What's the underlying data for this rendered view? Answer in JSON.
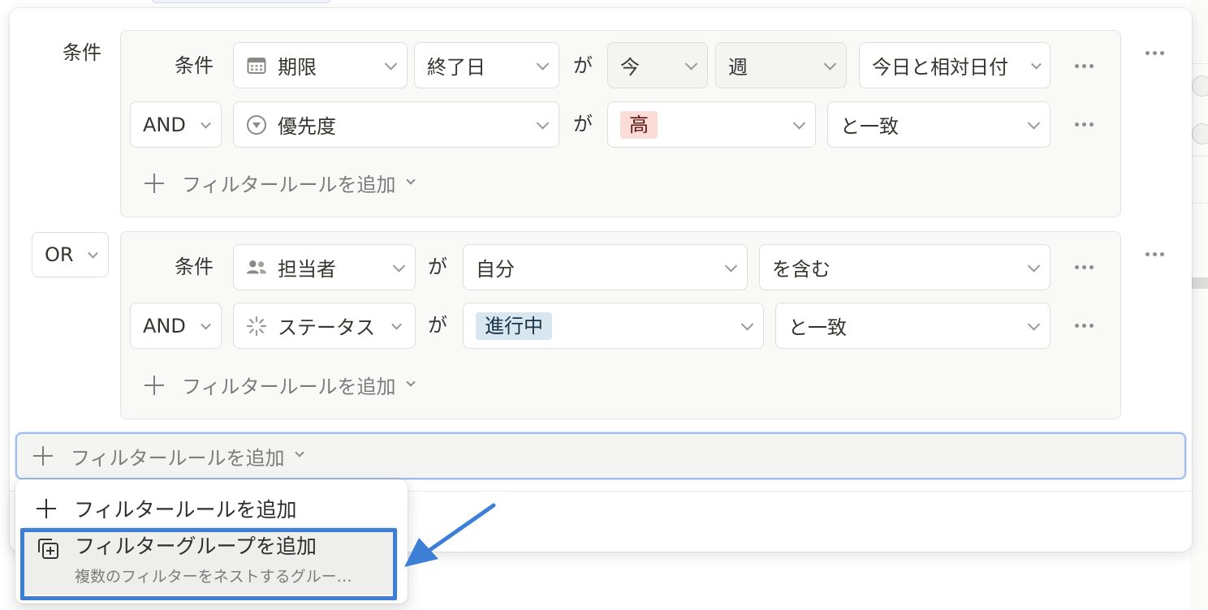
{
  "filters": {
    "top_label": "条件",
    "group1": {
      "rule1": {
        "prefix": "条件",
        "property": "期限",
        "property_icon": "calendar-icon",
        "field": "終了日",
        "verb": "が",
        "relative": "今",
        "unit": "週",
        "operator": "今日と相対日付"
      },
      "rule2": {
        "prefix": "AND",
        "property": "優先度",
        "property_icon": "select-icon",
        "verb": "が",
        "value": "高",
        "value_color": "#fbdcd7",
        "operator": "と一致"
      },
      "add_label": "フィルタールールを追加"
    },
    "group2_connector": "OR",
    "group2": {
      "rule1": {
        "prefix": "条件",
        "property": "担当者",
        "property_icon": "people-icon",
        "verb": "が",
        "value": "自分",
        "operator": "を含む"
      },
      "rule2": {
        "prefix": "AND",
        "property": "ステータス",
        "property_icon": "status-icon",
        "verb": "が",
        "value": "進行中",
        "value_color": "#d8e6ef",
        "operator": "と一致"
      },
      "add_label": "フィルタールールを追加"
    },
    "bottom_add_label": "フィルタールールを追加"
  },
  "menu": {
    "items": [
      {
        "label": "フィルタールールを追加",
        "icon": "plus-icon"
      },
      {
        "label": "フィルターグループを追加",
        "icon": "add-group-icon",
        "description": "複数のフィルターをネストするグルー…"
      }
    ]
  },
  "colors": {
    "highlight": "#3d7fd6",
    "focus_border": "#9ebfef"
  }
}
